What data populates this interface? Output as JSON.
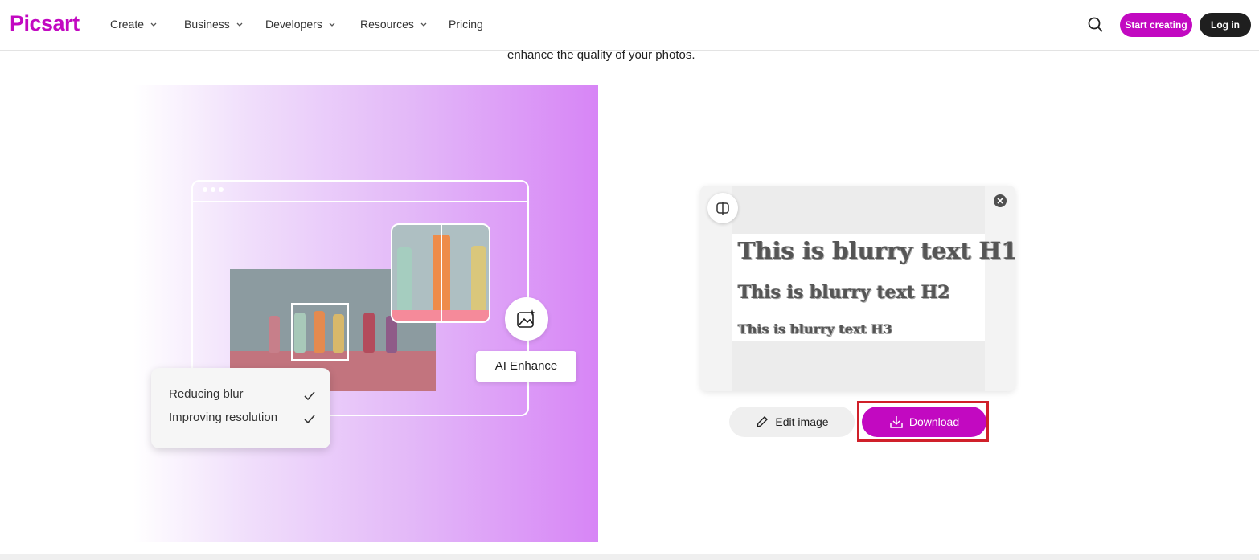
{
  "brand": {
    "logo": "Picsart",
    "accent": "#c209c1",
    "highlight": "#d0202a"
  },
  "nav": {
    "items": [
      {
        "label": "Create",
        "has_dropdown": true
      },
      {
        "label": "Business",
        "has_dropdown": true
      },
      {
        "label": "Developers",
        "has_dropdown": true
      },
      {
        "label": "Resources",
        "has_dropdown": true
      },
      {
        "label": "Pricing",
        "has_dropdown": false
      }
    ],
    "start_label": "Start creating",
    "login_label": "Log in"
  },
  "page": {
    "subtitle": "enhance the quality of your photos."
  },
  "hero": {
    "ai_label": "AI Enhance",
    "checks": [
      {
        "label": "Reducing blur"
      },
      {
        "label": "Improving resolution"
      }
    ]
  },
  "result": {
    "lines": [
      "This is blurry text H1",
      "This is blurry text H2",
      "This is blurry text H3"
    ],
    "edit_label": "Edit image",
    "download_label": "Download"
  }
}
